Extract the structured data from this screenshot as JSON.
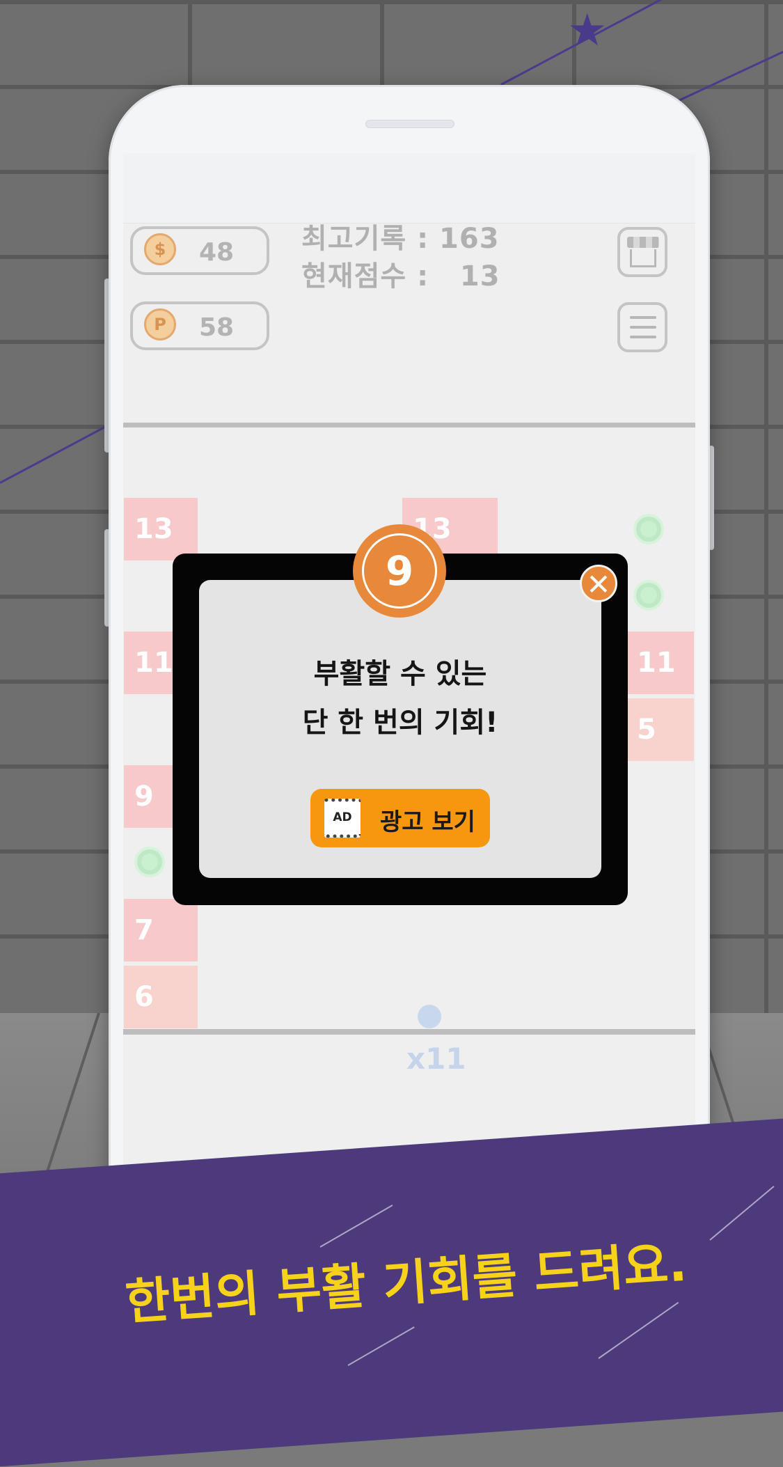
{
  "hud": {
    "coins": "48",
    "gems": "58",
    "best_score_line": "최고기록 : 163",
    "current_score_line": "현재점수 :   13",
    "coin_symbol": "$",
    "gem_symbol": "P"
  },
  "board": {
    "blocks": [
      {
        "value": "13",
        "col": 0,
        "row": 0,
        "color": "pink"
      },
      {
        "value": "13",
        "col": 4,
        "row": 0,
        "color": "pink"
      },
      {
        "value": "11",
        "col": 0,
        "row": 2,
        "color": "pink"
      },
      {
        "value": "11",
        "col": 7,
        "row": 2,
        "color": "pink"
      },
      {
        "value": "5",
        "col": 7,
        "row": 3,
        "color": "salmon"
      },
      {
        "value": "9",
        "col": 0,
        "row": 4,
        "color": "pink"
      },
      {
        "value": "7",
        "col": 0,
        "row": 6,
        "color": "pink"
      },
      {
        "value": "6",
        "col": 0,
        "row": 7,
        "color": "salmon"
      }
    ],
    "ball_multiplier": "x11"
  },
  "dialog": {
    "count": "9",
    "line1": "부활할 수 있는",
    "line2": "단 한 번의 기회!",
    "ad_icon_text": "AD",
    "ad_button_label": "광고 보기",
    "close_symbol": "✕"
  },
  "banner": {
    "caption": "한번의 부활 기회를 드려요."
  },
  "colors": {
    "accent_orange": "#f6970f",
    "badge_orange": "#e7883a",
    "banner_purple": "#4c3a7c",
    "caption_yellow": "#f7d21a"
  }
}
